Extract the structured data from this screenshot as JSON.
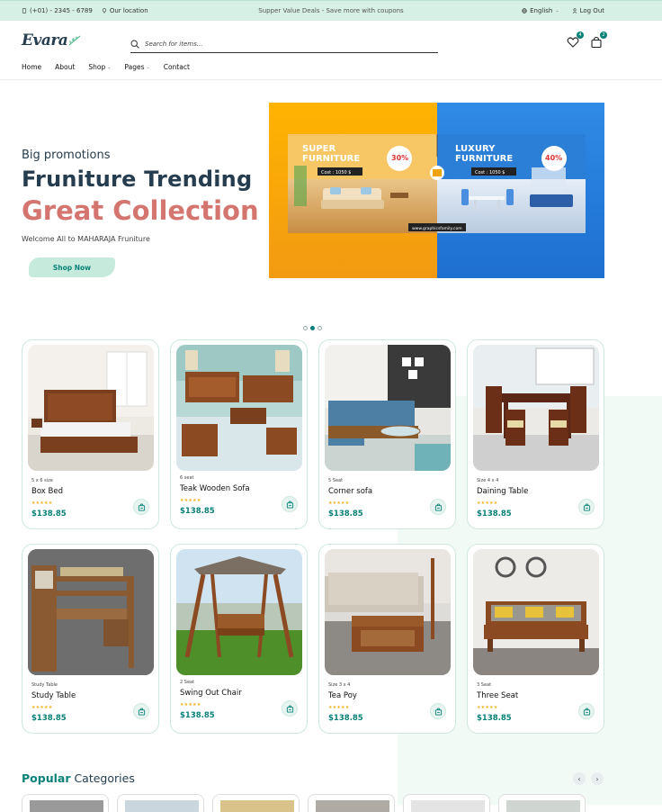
{
  "topbar": {
    "phone": "(+01) - 2345 - 6789",
    "location": "Our location",
    "promo": "Supper Value Deals - Save more with coupons",
    "language": "English",
    "logout": "Log Out"
  },
  "header": {
    "logo": "Evara",
    "search_placeholder": "Search for items...",
    "wishlist_count": "4",
    "cart_count": "2",
    "nav": [
      {
        "label": "Home"
      },
      {
        "label": "About"
      },
      {
        "label": "Shop"
      },
      {
        "label": "Pages"
      },
      {
        "label": "Contact"
      }
    ]
  },
  "hero": {
    "eyebrow": "Big promotions",
    "title": "Fruniture Trending",
    "highlight": "Great Collection",
    "subtitle": "Welcome All to MAHARAJA Fruniture",
    "button": "Shop Now",
    "banner": {
      "left_title_1": "SUPER",
      "left_title_2": "FURNITURE",
      "left_cost": "Cost : 1050 $",
      "left_pct": "30%",
      "right_title_1": "LUXURY",
      "right_title_2": "FURNITURE",
      "right_cost": "Cost : 1050 $",
      "right_pct": "40%",
      "url": "www.graphicsfamily.com"
    },
    "slides": 3,
    "active_slide": 2
  },
  "products": [
    {
      "category": "5 x 6 size",
      "name": "Box Bed",
      "price": "$138.85",
      "rating": 5,
      "art": "bed"
    },
    {
      "category": "6 seat",
      "name": "Teak Wooden Sofa",
      "price": "$138.85",
      "rating": 5,
      "art": "teak"
    },
    {
      "category": "5 Seat",
      "name": "Corner sofa",
      "price": "$138.85",
      "rating": 5,
      "art": "corner"
    },
    {
      "category": "Size 4 x 4",
      "name": "Daining Table",
      "price": "$138.85",
      "rating": 5,
      "art": "dining"
    },
    {
      "category": "Study Table",
      "name": "Study Table",
      "price": "$138.85",
      "rating": 5,
      "art": "study"
    },
    {
      "category": "2 Seat",
      "name": "Swing Out Chair",
      "price": "$138.85",
      "rating": 5,
      "art": "swing"
    },
    {
      "category": "Size 3 x 4",
      "name": "Tea Poy",
      "price": "$138.85",
      "rating": 5,
      "art": "teapoy"
    },
    {
      "category": "3 Seat",
      "name": "Three Seat",
      "price": "$138.85",
      "rating": 5,
      "art": "three"
    }
  ],
  "popular": {
    "accent": "Popular",
    "rest": " Categories"
  },
  "colors": {
    "brand": "#088178",
    "accent": "#d4756f",
    "topbar": "#d7f0e6",
    "stars": "#f2b01e"
  }
}
